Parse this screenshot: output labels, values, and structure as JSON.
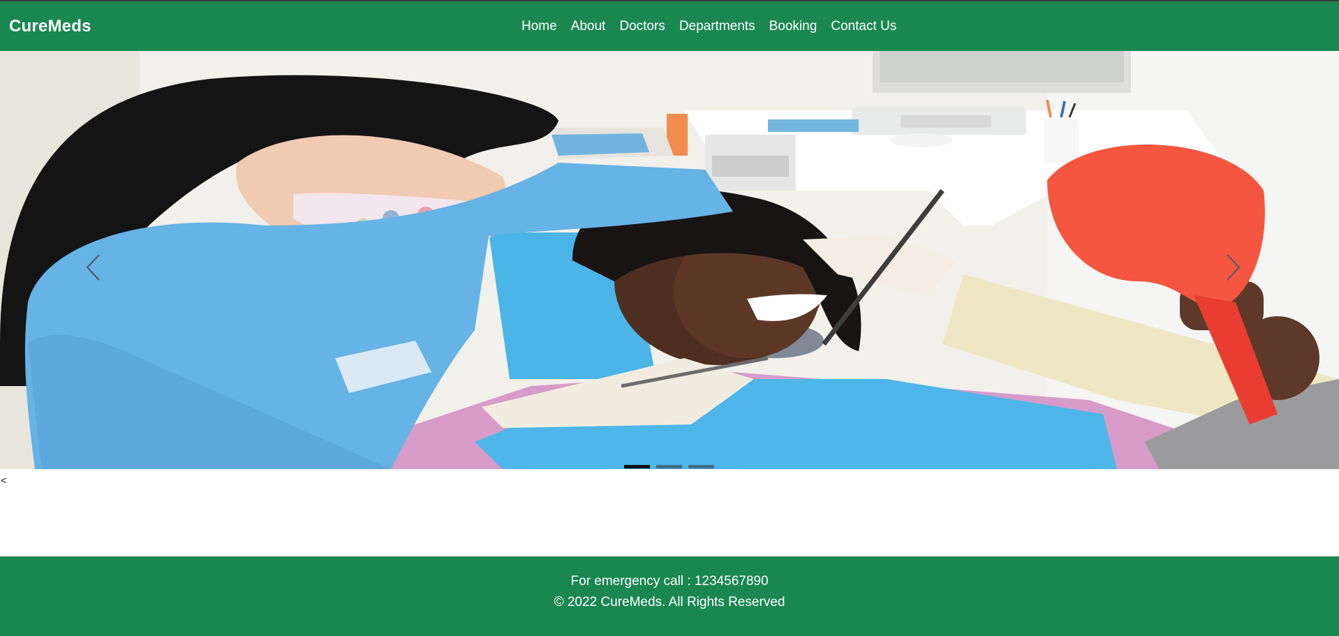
{
  "brand": "CureMeds",
  "nav": {
    "items": [
      "Home",
      "About",
      "Doctors",
      "Departments",
      "Booking",
      "Contact Us"
    ]
  },
  "carousel": {
    "prev_label": "‹",
    "next_label": "›",
    "slide_count": 3,
    "active_slide": 1,
    "image_description_icon": "dental-checkup-photo"
  },
  "stray_text": "<",
  "footer": {
    "emergency": "For emergency call : 1234567890",
    "copyright": "© 2022 CureMeds. All Rights Reserved"
  },
  "colors": {
    "primary": "#1a8751",
    "indicator_active": "#111111",
    "indicator_inactive": "#3f6e8a"
  }
}
